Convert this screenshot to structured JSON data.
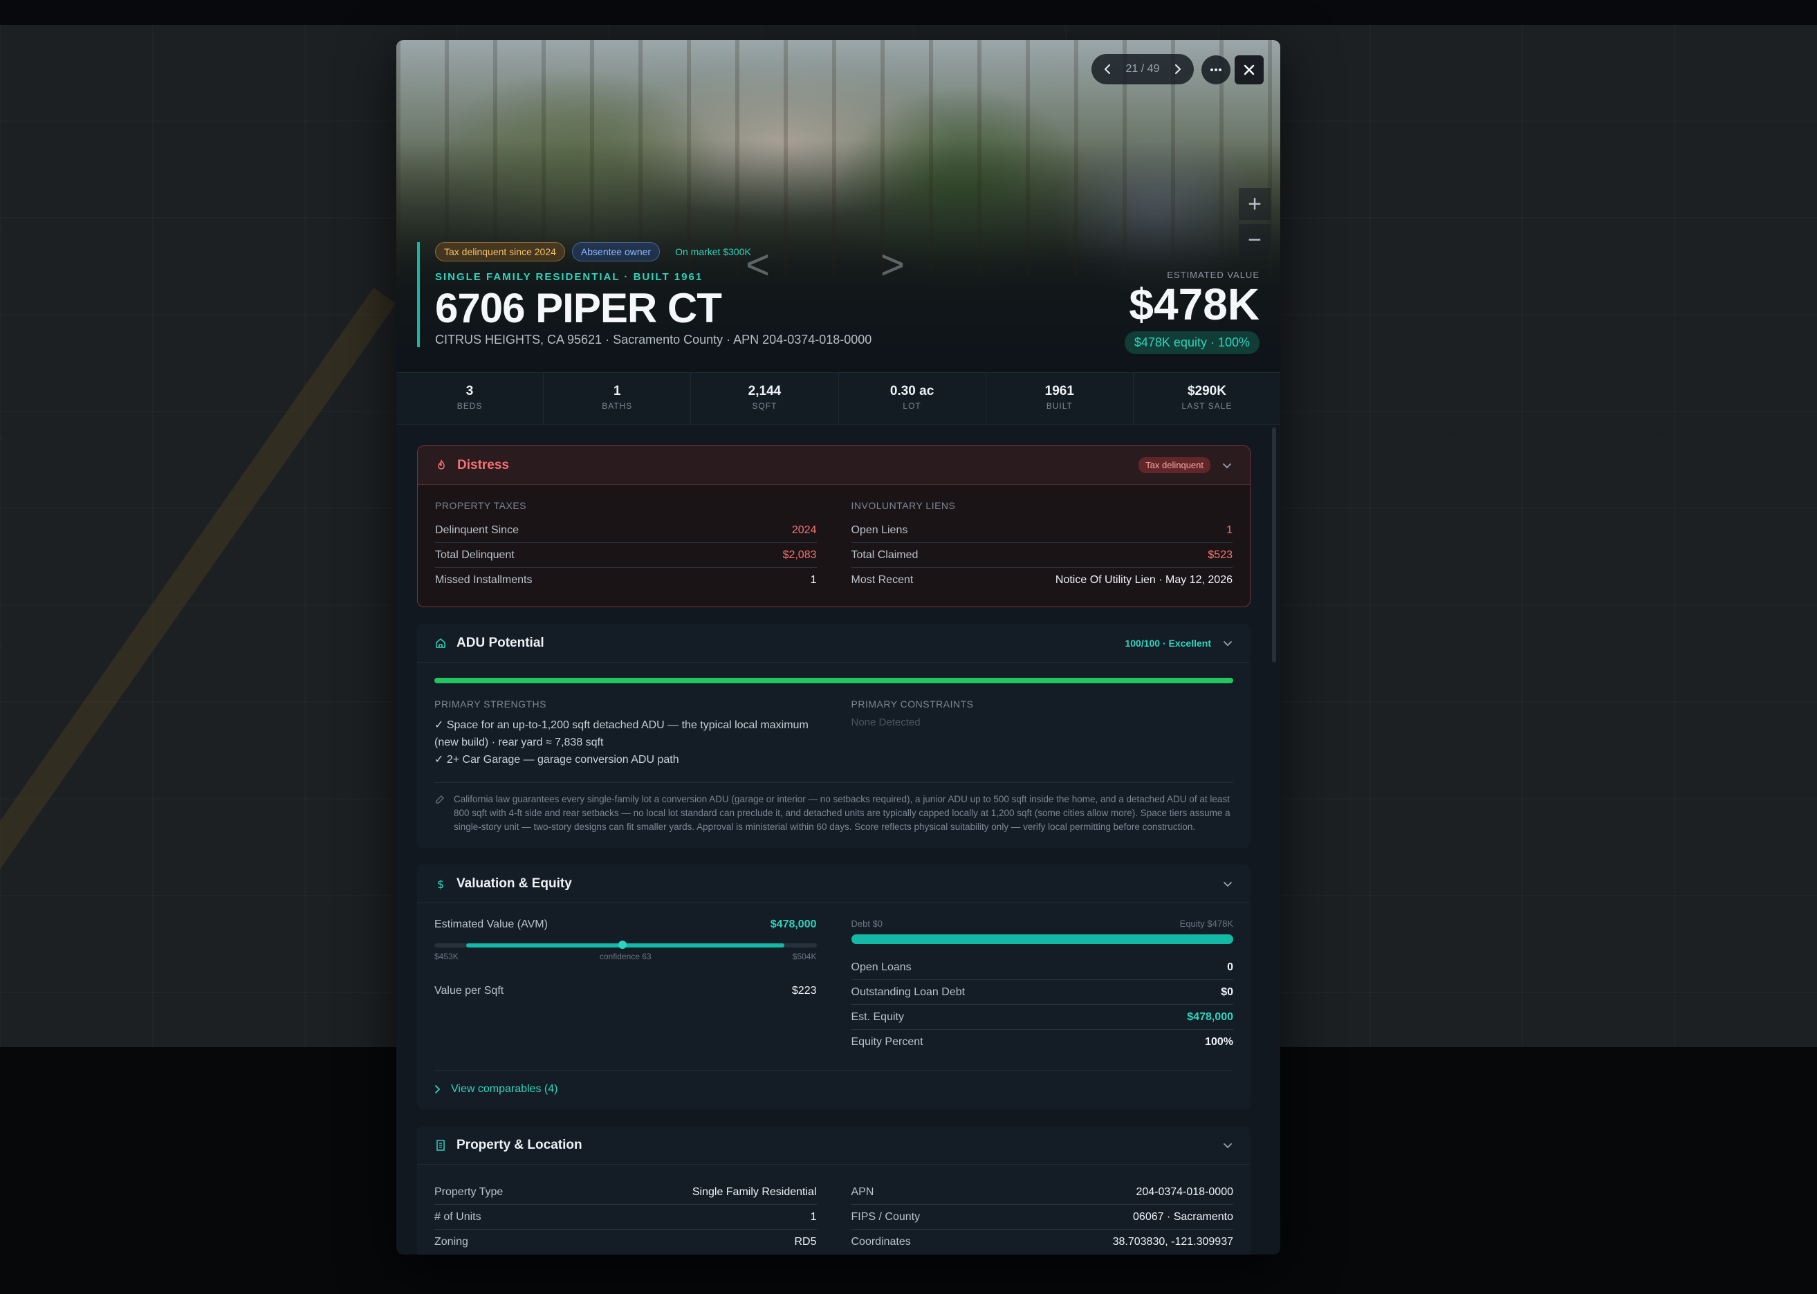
{
  "gallery": {
    "counter": "21 / 49"
  },
  "tags": {
    "delinquent": "Tax delinquent since 2024",
    "absentee": "Absentee owner",
    "market": "On market $300K"
  },
  "property": {
    "type_line": "SINGLE FAMILY RESIDENTIAL · BUILT 1961",
    "address": "6706 PIPER CT",
    "subaddress": "CITRUS HEIGHTS, CA 95621 · Sacramento County · APN 204-0374-018-0000",
    "value_label": "ESTIMATED VALUE",
    "value": "$478K",
    "equity": "$478K equity · 100%"
  },
  "stats": [
    {
      "value": "3",
      "label": "BEDS"
    },
    {
      "value": "1",
      "label": "BATHS"
    },
    {
      "value": "2,144",
      "label": "SQFT"
    },
    {
      "value": "0.30 ac",
      "label": "LOT"
    },
    {
      "value": "1961",
      "label": "BUILT"
    },
    {
      "value": "$290K",
      "label": "LAST SALE"
    }
  ],
  "distress": {
    "title": "Distress",
    "badge": "Tax delinquent",
    "taxes_label": "PROPERTY TAXES",
    "taxes": [
      {
        "k": "Delinquent Since",
        "v": "2024"
      },
      {
        "k": "Total Delinquent",
        "v": "$2,083"
      },
      {
        "k": "Missed Installments",
        "v": "1"
      }
    ],
    "liens_label": "INVOLUNTARY LIENS",
    "liens": [
      {
        "k": "Open Liens",
        "v": "1"
      },
      {
        "k": "Total Claimed",
        "v": "$523"
      },
      {
        "k": "Most Recent",
        "v": "Notice Of Utility Lien · May 12, 2026"
      }
    ]
  },
  "adu": {
    "title": "ADU Potential",
    "score": "100/100 · Excellent",
    "score_fraction": 1.0,
    "strengths_label": "PRIMARY STRENGTHS",
    "strengths": [
      "✓ Space for an up-to-1,200 sqft detached ADU — the typical local maximum (new build) · rear yard ≈ 7,838 sqft",
      "✓ 2+ Car Garage — garage conversion ADU path"
    ],
    "constraints_label": "PRIMARY CONSTRAINTS",
    "constraints": "None Detected",
    "note": "California law guarantees every single-family lot a conversion ADU (garage or interior — no setbacks required), a junior ADU up to 500 sqft inside the home, and a detached ADU of at least 800 sqft with 4-ft side and rear setbacks — no local lot standard can preclude it, and detached units are typically capped locally at 1,200 sqft (some cities allow more). Space tiers assume a single-story unit — two-story designs can fit smaller yards. Approval is ministerial within 60 days. Score reflects physical suitability only — verify local permitting before construction."
  },
  "valuation": {
    "title": "Valuation & Equity",
    "avm_label": "Estimated Value (AVM)",
    "avm_value": "$478,000",
    "range_low": "$453K",
    "range_high": "$504K",
    "confidence": "confidence 63",
    "range_low_num": 453,
    "range_high_num": 504,
    "avm_num": 478,
    "vps_label": "Value per Sqft",
    "vps_value": "$223",
    "debt_label": "Debt $0",
    "equity_label": "Equity $478K",
    "equity_fraction": 1.0,
    "rows": [
      {
        "k": "Open Loans",
        "v": "0"
      },
      {
        "k": "Outstanding Loan Debt",
        "v": "$0"
      },
      {
        "k": "Est. Equity",
        "v": "$478,000"
      },
      {
        "k": "Equity Percent",
        "v": "100%"
      }
    ],
    "comparables": "View comparables (4)"
  },
  "location": {
    "title": "Property & Location",
    "left": [
      {
        "k": "Property Type",
        "v": "Single Family Residential"
      },
      {
        "k": "# of Units",
        "v": "1"
      },
      {
        "k": "Zoning",
        "v": "RD5"
      }
    ],
    "right": [
      {
        "k": "APN",
        "v": "204-0374-018-0000"
      },
      {
        "k": "FIPS / County",
        "v": "06067 · Sacramento"
      },
      {
        "k": "Coordinates",
        "v": "38.703830, -121.309937"
      }
    ]
  },
  "colors": {
    "accent": "#14b8a6",
    "danger": "#f87171",
    "success": "#22c55e",
    "modal_bg": "#111820"
  },
  "icons": [
    "chevron-left-icon",
    "chevron-right-icon",
    "more-icon",
    "close-icon",
    "zoom-in-icon",
    "zoom-out-icon",
    "flame-icon",
    "home-icon",
    "dollar-icon",
    "building-icon",
    "chevron-down-icon",
    "pencil-icon"
  ]
}
